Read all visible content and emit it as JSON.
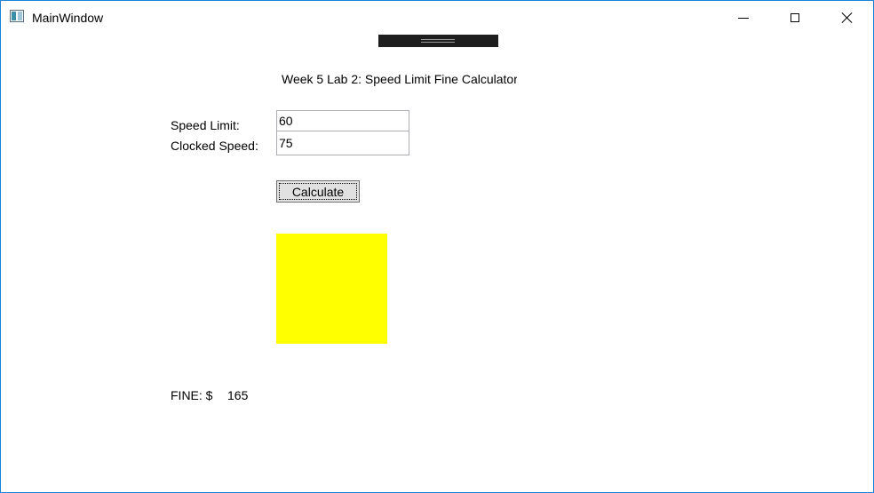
{
  "window": {
    "title": "MainWindow",
    "icon": "app-window-icon",
    "controls": [
      "minimize-icon",
      "maximize-icon",
      "close-icon"
    ]
  },
  "heading": "Week 5 Lab 2: Speed Limit Fine Calculator",
  "form": {
    "speed_limit_label": "Speed Limit:",
    "speed_limit_value": "60",
    "clocked_speed_label": "Clocked Speed:",
    "clocked_speed_value": "75",
    "calculate_label": "Calculate"
  },
  "result": {
    "fine_label": "FINE: $",
    "fine_value": "165",
    "indicator_color": "#ffff00"
  },
  "colors": {
    "window_border": "#1883d7",
    "debug_toolbar": "#1e1e1e"
  }
}
